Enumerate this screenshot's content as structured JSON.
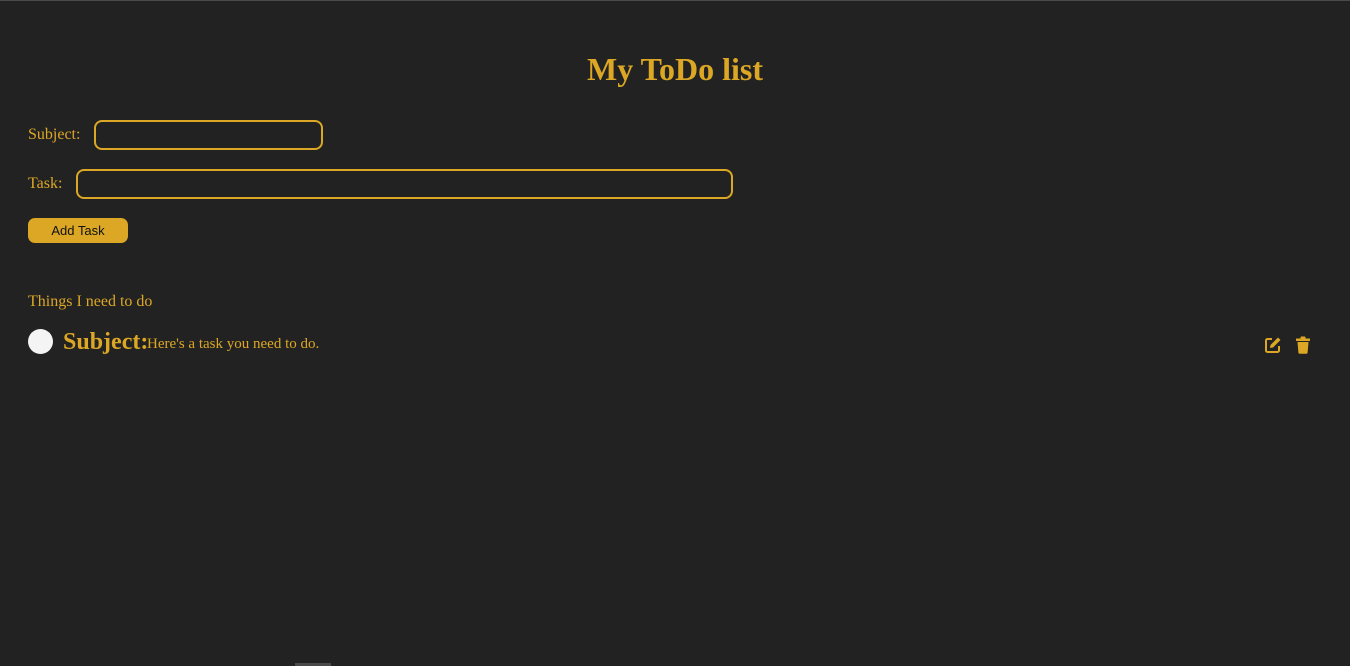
{
  "page": {
    "title": "My ToDo list"
  },
  "form": {
    "subject_label": "Subject:",
    "subject_value": "",
    "task_label": "Task:",
    "task_value": "",
    "add_button_label": "Add Task"
  },
  "list": {
    "heading": "Things I need to do",
    "items": [
      {
        "subject": "Subject:",
        "text": "Here's a task you need to do.",
        "completed": false
      }
    ]
  },
  "icons": {
    "edit": "edit-icon",
    "delete": "trash-icon"
  },
  "colors": {
    "background": "#232222",
    "accent": "#dba724",
    "checkbox": "#f4f4f4"
  }
}
